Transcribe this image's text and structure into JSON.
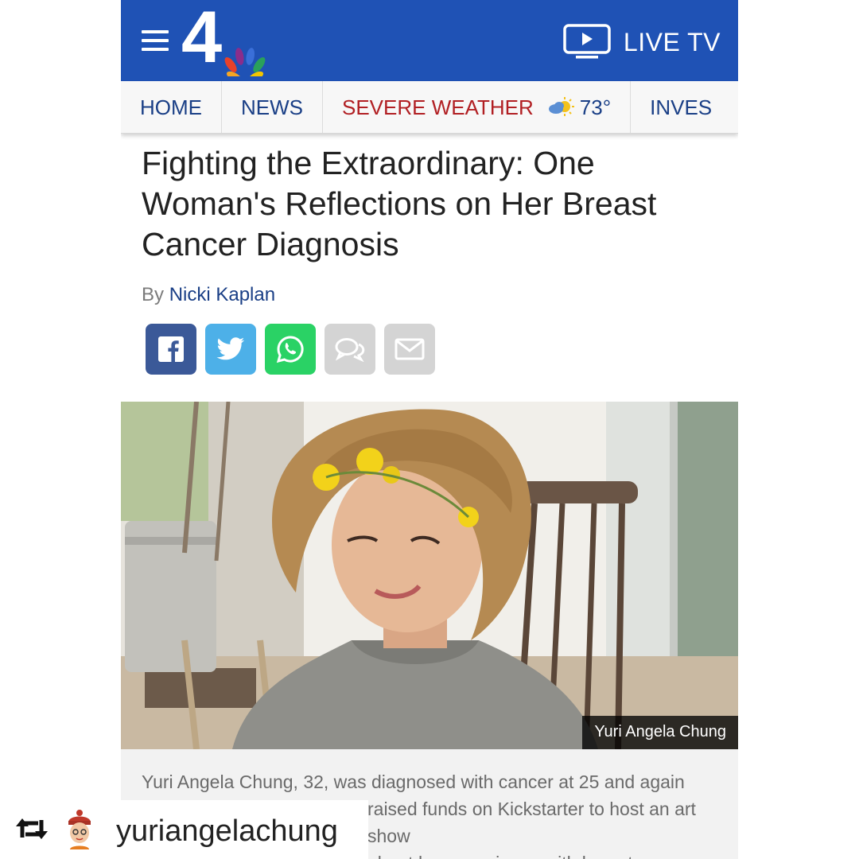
{
  "header": {
    "logo_text": "4",
    "live_tv_label": "LIVE TV"
  },
  "nav": {
    "items": [
      {
        "label": "HOME"
      },
      {
        "label": "NEWS"
      },
      {
        "label": "SEVERE WEATHER"
      },
      {
        "label": "INVES"
      }
    ],
    "weather_temp": "73°"
  },
  "article": {
    "headline": "Fighting the Extraordinary: One Woman's Reflections on Her Breast Cancer Diagnosis",
    "byline_prefix": "By",
    "author": "Nicki Kaplan",
    "share_buttons": [
      "facebook-icon",
      "twitter-icon",
      "whatsapp-icon",
      "comment-icon",
      "email-icon"
    ],
    "photo_credit": "Yuri Angela Chung",
    "caption_lines": [
      "Yuri Angela Chung, 32, was diagnosed with cancer at 25 and again",
      "raised funds on Kickstarter to host an art show",
      "about her experience with breast cancer."
    ]
  },
  "repost": {
    "username": "yuriangelachung"
  },
  "colors": {
    "header_blue": "#1f52b5",
    "nav_link": "#1a3f86",
    "severe_red": "#b11f23"
  }
}
